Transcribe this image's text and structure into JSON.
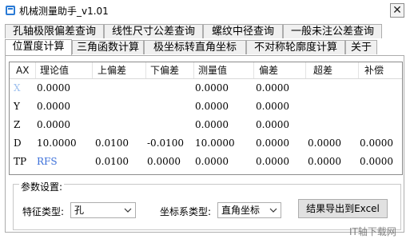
{
  "window": {
    "title": "机械测量助手_v1.01",
    "close_glyph": "✕"
  },
  "tabs_row1": [
    "孔轴极限偏差查询",
    "线性尺寸公差查询",
    "螺纹中径查询",
    "一般未注公差查询"
  ],
  "tabs_row2": [
    "位置度计算",
    "三角函数计算",
    "极坐标转直角坐标",
    "不对称轮廓度计算",
    "关于"
  ],
  "active_tab": "位置度计算",
  "grid": {
    "headers": [
      "AX",
      "理论值",
      "上偏差",
      "下偏差",
      "测量值",
      "偏差",
      "超差",
      "补偿"
    ],
    "rows": [
      [
        "X",
        "0.0000",
        "",
        "",
        "0.0000",
        "0.0000",
        "",
        ""
      ],
      [
        "Y",
        "0.0000",
        "",
        "",
        "0.0000",
        "0.0000",
        "",
        ""
      ],
      [
        "Z",
        "0.0000",
        "",
        "",
        "0.0000",
        "0.0000",
        "",
        ""
      ],
      [
        "D",
        "10.0000",
        "0.0100",
        "-0.0100",
        "10.0000",
        "0.0000",
        "0.0000",
        "0.0000"
      ],
      [
        "TP",
        "RFS",
        "0.0100",
        "0.0000",
        "0.0000",
        "0.0000",
        "0.0000",
        "0.0000"
      ]
    ]
  },
  "params": {
    "group_label": "参数设置:",
    "feature_label": "特征类型:",
    "feature_value": "孔",
    "coord_label": "坐标系类型:",
    "coord_value": "直角坐标",
    "export_button": "结果导出到Excel"
  },
  "watermark": "IT轴下载网"
}
